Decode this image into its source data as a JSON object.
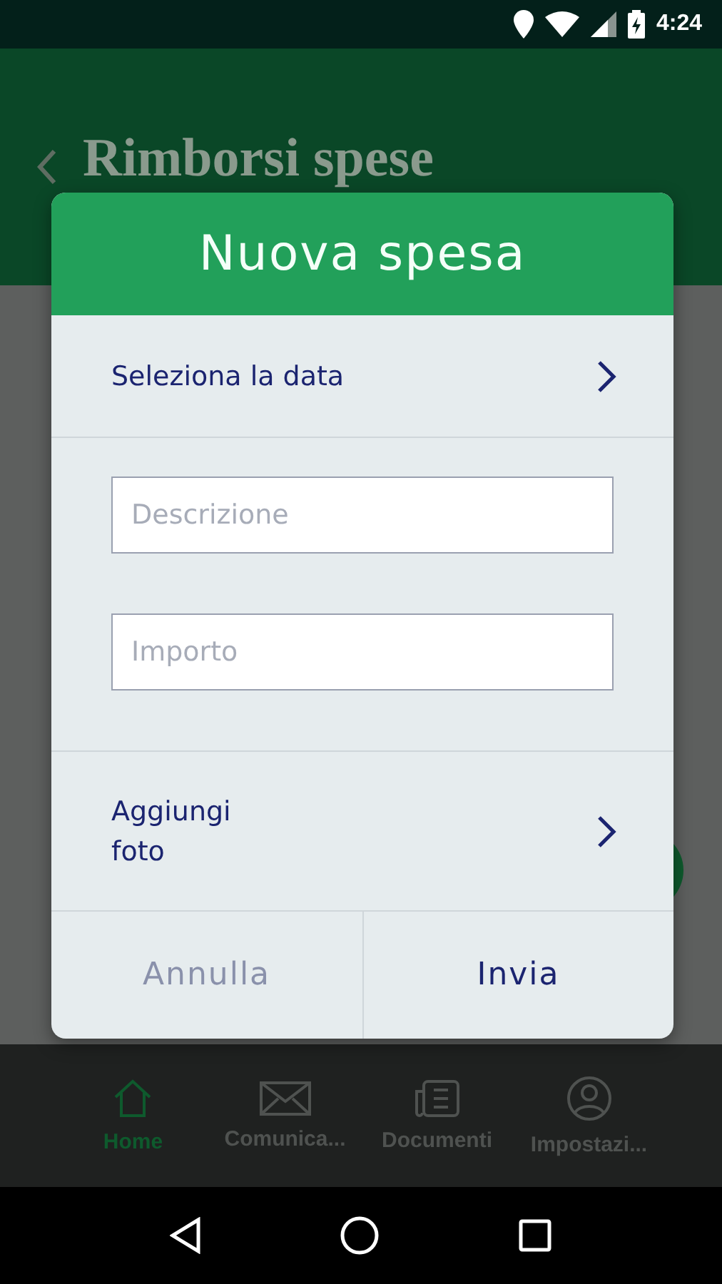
{
  "status_bar": {
    "time": "4:24"
  },
  "header": {
    "title": "Rimborsi spese"
  },
  "bottom_nav": [
    {
      "label": "Home",
      "kind": "home",
      "selected": true
    },
    {
      "label": "Comunica...",
      "kind": "mail",
      "selected": false
    },
    {
      "label": "Documenti",
      "kind": "docs",
      "selected": false
    },
    {
      "label": "Impostazi...",
      "kind": "user",
      "selected": false
    }
  ],
  "dialog": {
    "title": "Nuova spesa",
    "date_row": {
      "label": "Seleziona la data"
    },
    "fields": [
      {
        "placeholder": "Descrizione"
      },
      {
        "placeholder": "Importo"
      }
    ],
    "photo_row": {
      "label": "Aggiungi foto"
    },
    "buttons": [
      {
        "label": "Annulla",
        "kind": "cancel"
      },
      {
        "label": "Invia",
        "kind": "confirm"
      }
    ]
  }
}
